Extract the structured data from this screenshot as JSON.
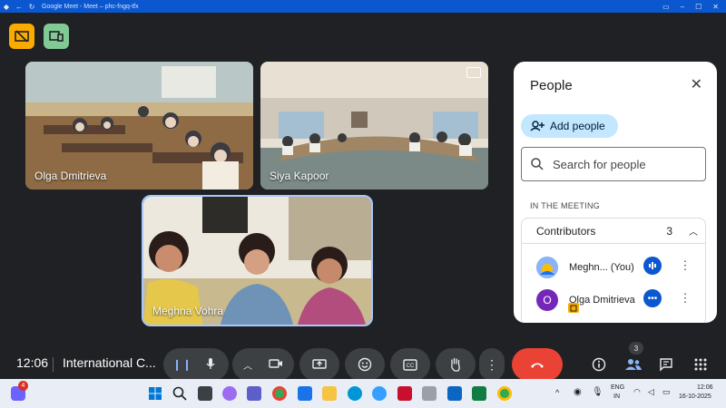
{
  "window": {
    "title": "Google Meet - Meet – phc-fngq-tfx",
    "controls": [
      "minimize",
      "maximize",
      "close"
    ]
  },
  "tiles": [
    {
      "name": "Olga Dmitrieva"
    },
    {
      "name": "Siya Kapoor"
    },
    {
      "name": "Meghna Vohra"
    }
  ],
  "people_panel": {
    "title": "People",
    "add_people": "Add people",
    "search_placeholder": "Search for people",
    "section": "IN THE MEETING",
    "contributors_label": "Contributors",
    "contributors_count": "3",
    "participants": [
      {
        "name": "Meghn... (You)",
        "avatar": "",
        "avatar_color": "#8ab4f8"
      },
      {
        "name": "Olga Dmitrieva",
        "avatar": "O",
        "avatar_color": "#7627bb"
      }
    ]
  },
  "bottom_bar": {
    "time": "12:06",
    "meeting_name": "International C...",
    "people_badge": "3"
  },
  "taskbar": {
    "lang": "ENG",
    "region": "IN",
    "time": "12:06",
    "date": "16-10-2025",
    "notif_badge": "4"
  },
  "colors": {
    "accent": "#0b57d0",
    "end_call": "#ea4335",
    "meet_bg": "#202124",
    "panel_chip": "#c2e7ff"
  }
}
